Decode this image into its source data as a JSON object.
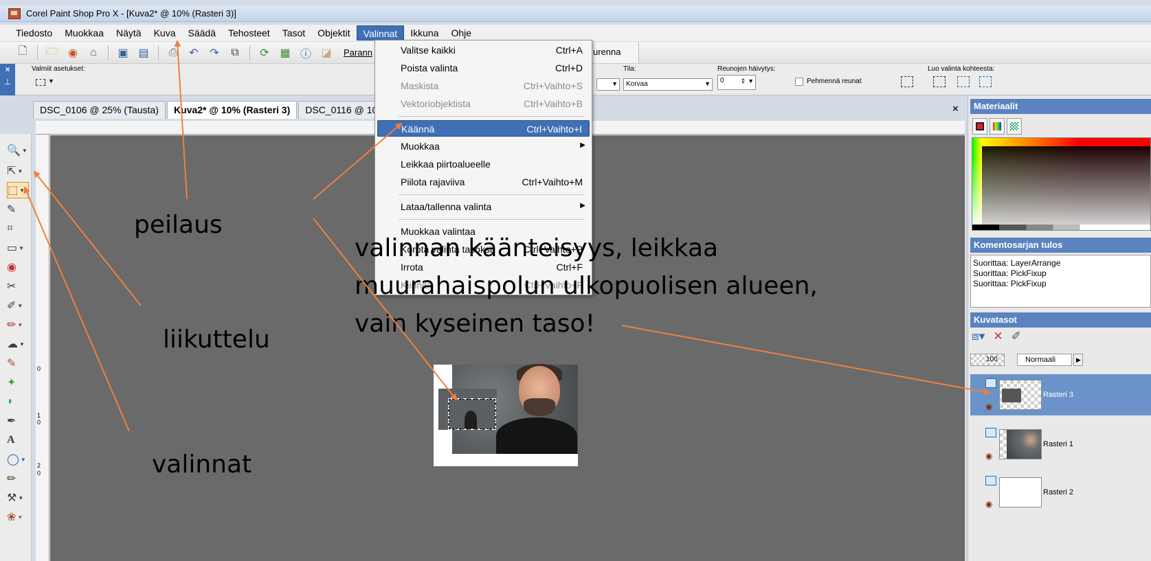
{
  "window": {
    "title": "Corel Paint Shop Pro X - [Kuva2* @ 10% (Rasteri 3)]"
  },
  "menubar": [
    {
      "label": "Tiedosto",
      "active": false
    },
    {
      "label": "Muokkaa",
      "active": false
    },
    {
      "label": "Näytä",
      "active": false
    },
    {
      "label": "Kuva",
      "active": false
    },
    {
      "label": "Säädä",
      "active": false
    },
    {
      "label": "Tehosteet",
      "active": false
    },
    {
      "label": "Tasot",
      "active": false
    },
    {
      "label": "Objektit",
      "active": false
    },
    {
      "label": "Valinnat",
      "active": true
    },
    {
      "label": "Ikkuna",
      "active": false
    },
    {
      "label": "Ohje",
      "active": false
    }
  ],
  "toolbar": {
    "partial_label_left": "Parann",
    "partial_label_right": "urenna"
  },
  "tool_options": {
    "presets_label": "Valmiit asetukset:",
    "mode_label": "Tila:",
    "mode_value": "Korvaa",
    "feather_label": "Reunojen häivytys:",
    "feather_value": "0",
    "antialias_label": "Pehmennä reunat",
    "create_from_label": "Luo valinta kohteesta:"
  },
  "doc_tabs": [
    {
      "label": "DSC_0106 @ 25% (Tausta)",
      "active": false
    },
    {
      "label": "Kuva2* @ 10% (Rasteri 3)",
      "active": true
    },
    {
      "label": "DSC_0116 @ 100%",
      "active": false
    }
  ],
  "doc_close": "×",
  "ruler": {
    "left_numbers": [
      "0",
      "1",
      "0",
      "2",
      "0"
    ]
  },
  "dropdown": {
    "items": [
      {
        "label": "Valitse kaikki",
        "shortcut": "Ctrl+A",
        "disabled": false,
        "highlight": false,
        "submenu": false
      },
      {
        "label": "Poista valinta",
        "shortcut": "Ctrl+D",
        "disabled": false,
        "highlight": false,
        "submenu": false
      },
      {
        "label": "Maskista",
        "shortcut": "Ctrl+Vaihto+S",
        "disabled": true,
        "highlight": false,
        "submenu": false
      },
      {
        "label": "Vektoriobjektista",
        "shortcut": "Ctrl+Vaihto+B",
        "disabled": true,
        "highlight": false,
        "submenu": false
      },
      {
        "label": "Käännä",
        "shortcut": "Ctrl+Vaihto+I",
        "disabled": false,
        "highlight": true,
        "submenu": false
      },
      {
        "label": "Muokkaa",
        "shortcut": "",
        "disabled": false,
        "highlight": false,
        "submenu": true
      },
      {
        "label": "Leikkaa piirtoalueelle",
        "shortcut": "",
        "disabled": false,
        "highlight": false,
        "submenu": false
      },
      {
        "label": "Piilota rajaviiva",
        "shortcut": "Ctrl+Vaihto+M",
        "disabled": false,
        "highlight": false,
        "submenu": false
      },
      {
        "label": "Lataa/tallenna valinta",
        "shortcut": "",
        "disabled": false,
        "highlight": false,
        "submenu": true
      },
      {
        "label": "Muokkaa valintaa",
        "shortcut": "",
        "disabled": false,
        "highlight": false,
        "submenu": false
      },
      {
        "label": "Korota valinta tasoksi",
        "shortcut": "Ctrl+Vaihto+P",
        "disabled": false,
        "highlight": false,
        "submenu": false
      },
      {
        "label": "Irrota",
        "shortcut": "Ctrl+F",
        "disabled": false,
        "highlight": false,
        "submenu": false
      },
      {
        "label": "Kiinnitä",
        "shortcut": "Ctrl+Vaihto+F",
        "disabled": true,
        "highlight": false,
        "submenu": false
      }
    ]
  },
  "panels": {
    "materials_title": "Materiaalit",
    "script_title": "Komentosarjan tulos",
    "script_lines": [
      "Suorittaa: LayerArrange",
      "Suorittaa: PickFixup",
      "Suorittaa: PickFixup"
    ],
    "layers_title": "Kuvatasot",
    "opacity_value": "100",
    "blend_mode": "Normaali",
    "layers": [
      {
        "name": "Rasteri 3",
        "selected": true
      },
      {
        "name": "Rasteri 1",
        "selected": false
      },
      {
        "name": "Rasteri 2",
        "selected": false
      }
    ]
  },
  "annotations": {
    "peilaus": "peilaus",
    "liikuttelu": "liikuttelu",
    "valinnat": "valinnat",
    "main_lines": [
      "valinnan käänteisyys, leikkaa",
      "muurahaispolun ulkopuolisen alueen,",
      "vain kyseinen taso!"
    ]
  },
  "colors": {
    "arrow": "#f0803c",
    "menu_highlight": "#3f6fb5",
    "panel_header": "#5a83bf",
    "canvas_bg": "#6a6a6a"
  }
}
